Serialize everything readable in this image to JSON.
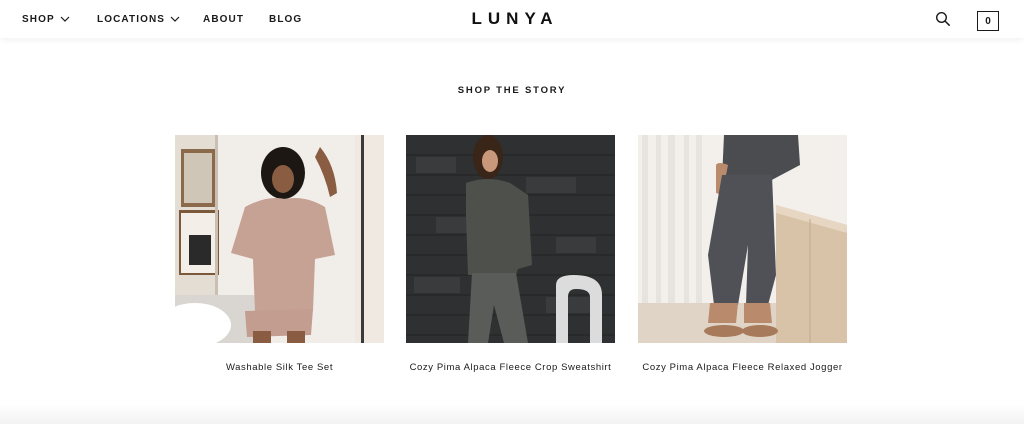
{
  "header": {
    "nav": [
      {
        "label": "SHOP",
        "has_dropdown": true
      },
      {
        "label": "LOCATIONS",
        "has_dropdown": true
      },
      {
        "label": "ABOUT",
        "has_dropdown": false
      },
      {
        "label": "BLOG",
        "has_dropdown": false
      }
    ],
    "logo": "LUNYA",
    "search_icon": "search-icon",
    "cart_count": "0"
  },
  "main": {
    "section_title": "SHOP THE STORY",
    "products": [
      {
        "name": "Washable Silk Tee Set",
        "image": "model-in-pink-silk-tee-set"
      },
      {
        "name": "Cozy Pima Alpaca Fleece Crop Sweatshirt",
        "image": "model-in-grey-crop-sweatshirt"
      },
      {
        "name": "Cozy Pima Alpaca Fleece Relaxed Jogger",
        "image": "model-in-charcoal-jogger"
      }
    ]
  },
  "colors": {
    "text": "#1a1a1a",
    "background": "#ffffff"
  }
}
